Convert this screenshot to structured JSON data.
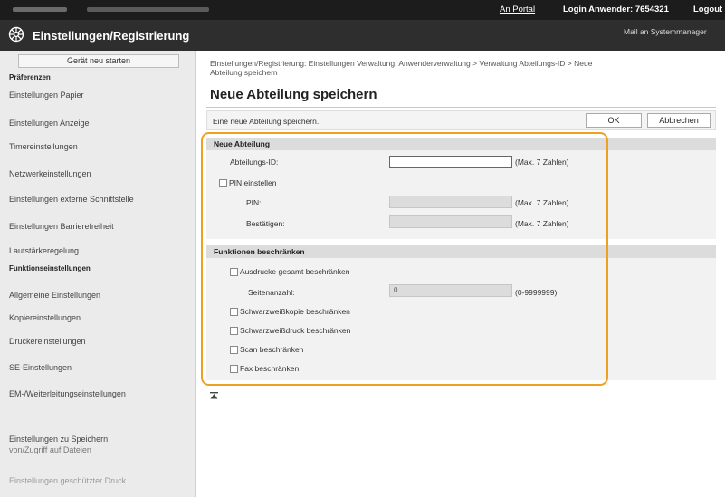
{
  "topbar": {
    "portal_link": "An Portal",
    "login_text": "Login Anwender:  7654321",
    "logout_link": "Logout"
  },
  "header": {
    "title": "Einstellungen/Registrierung",
    "mail_link": "Mail an Systemmanager"
  },
  "sidebar": {
    "restart_button": "Gerät neu starten",
    "section_preferences": "Präferenzen",
    "pref_items": [
      "Einstellungen Papier",
      "Einstellungen Anzeige",
      "Timereinstellungen",
      "Netzwerkeinstellungen",
      "Einstellungen externe Schnittstelle",
      "Einstellungen Barrierefreiheit",
      "Lautstärkeregelung"
    ],
    "section_functions": "Funktionseinstellungen",
    "func_items": [
      "Allgemeine Einstellungen",
      "Kopiereinstellungen",
      "Druckereinstellungen",
      "SE-Einstellungen",
      "EM-/Weiterleitungseinstellungen"
    ],
    "data_access_line1": "Einstellungen zu Speichern",
    "data_access_line2": "von/Zugriff auf Dateien",
    "secure_print": "Einstellungen geschützter Druck"
  },
  "main": {
    "breadcrumb_line1": "Einstellungen/Registrierung: Einstellungen Verwaltung: Anwenderverwaltung > Verwaltung Abteilungs-ID > Neue",
    "breadcrumb_line2": "Abteilung speichern",
    "page_title": "Neue Abteilung speichern",
    "description": "Eine neue Abteilung speichern.",
    "ok_button": "OK",
    "cancel_button": "Abbrechen",
    "section_new_dept": {
      "heading": "Neue Abteilung",
      "dept_id_label": "Abteilungs-ID:",
      "dept_id_value": "",
      "dept_id_hint": "(Max. 7 Zahlen)",
      "pin_checkbox_label": "PIN einstellen",
      "pin_label": "PIN:",
      "pin_hint": "(Max. 7 Zahlen)",
      "confirm_label": "Bestätigen:",
      "confirm_hint": "(Max. 7 Zahlen)"
    },
    "section_restrict": {
      "heading": "Funktionen beschränken",
      "total_prints_label": "Ausdrucke gesamt beschränken",
      "page_count_label": "Seitenanzahl:",
      "page_count_value": "0",
      "page_count_hint": "(0-9999999)",
      "bw_copy_label": "Schwarzweißkopie beschränken",
      "bw_print_label": "Schwarzweißdruck beschränken",
      "scan_label": "Scan beschränken",
      "fax_label": "Fax beschränken"
    }
  },
  "colors": {
    "highlight_frame": "#f0a020",
    "topbar": "#1c1c1c",
    "titlebar": "#2e2e2e"
  }
}
